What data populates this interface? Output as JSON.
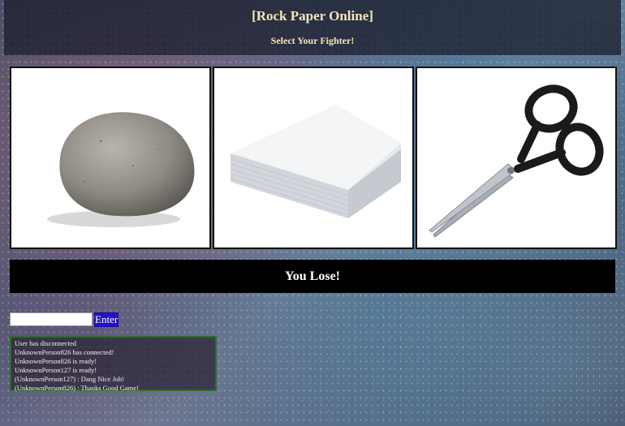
{
  "header": {
    "title": "[Rock Paper Online]",
    "subtitle": "Select Your Fighter!"
  },
  "fighters": [
    {
      "name": "rock",
      "icon": "rock-image"
    },
    {
      "name": "paper",
      "icon": "paper-image"
    },
    {
      "name": "scissors",
      "icon": "scissors-image"
    }
  ],
  "result": {
    "text": "You Lose!"
  },
  "chat": {
    "input_value": "",
    "enter_label": "Enter",
    "messages": [
      "User has disconnected",
      "UnknownPerson826 has connected!",
      "UnknownPerson826 is ready!",
      "UnknownPerson127 is ready!",
      "(UnknownPerson127) : Dang Nice Job!",
      "(UnknownPerson826) : Thanks Good Game!"
    ]
  },
  "colors": {
    "header_text": "#f5e6b8",
    "enter_button": "#2211c8",
    "chat_border": "#2e6b2c"
  }
}
